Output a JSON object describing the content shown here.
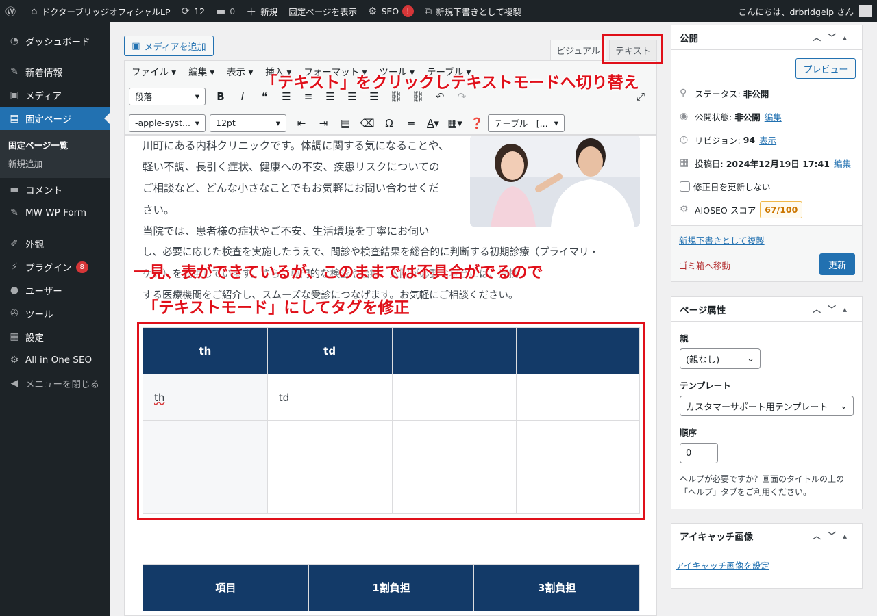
{
  "adminbar": {
    "site_name": "ドクターブリッジオフィシャルLP",
    "updates": "12",
    "comments": "0",
    "new_label": "新規",
    "view_page": "固定ページを表示",
    "seo": "SEO",
    "seo_alert": "!",
    "duplicate": "新規下書きとして複製",
    "greeting": "こんにちは、drbridgelp さん"
  },
  "sidebar": {
    "items": [
      {
        "label": "ダッシュボード",
        "icon": "dashboard-icon"
      },
      {
        "label": "新着情報",
        "icon": "pin-icon"
      },
      {
        "label": "メディア",
        "icon": "media-icon"
      },
      {
        "label": "固定ページ",
        "icon": "page-icon"
      },
      {
        "label": "コメント",
        "icon": "comment-icon"
      },
      {
        "label": "MW WP Form",
        "icon": "pin-icon"
      },
      {
        "label": "外観",
        "icon": "brush-icon"
      },
      {
        "label": "プラグイン",
        "icon": "plugin-icon",
        "badge": "8"
      },
      {
        "label": "ユーザー",
        "icon": "user-icon"
      },
      {
        "label": "ツール",
        "icon": "wrench-icon"
      },
      {
        "label": "設定",
        "icon": "settings-icon"
      },
      {
        "label": "All in One SEO",
        "icon": "aioseo-icon"
      },
      {
        "label": "メニューを閉じる",
        "icon": "collapse-icon"
      }
    ],
    "submenu": [
      "固定ページ一覧",
      "新規追加"
    ]
  },
  "editor": {
    "add_media": "メディアを追加",
    "tab_visual": "ビジュアル",
    "tab_text": "テキスト",
    "menus": [
      "ファイル",
      "編集",
      "表示",
      "挿入",
      "フォーマット",
      "ツール",
      "テーブル"
    ],
    "format_select": "段落",
    "font_select": "-apple-syst...",
    "size_select": "12pt",
    "table_select": "テーブル　[...",
    "paragraph_lines": [
      "川町にある内科クリニックです。体調に関する気になることや、",
      "軽い不調、長引く症状、健康への不安、疾患リスクについての",
      "ご相談など、どんな小さなことでもお気軽にお問い合わせくだ",
      "さい。",
      "当院では、患者様の症状やご不安、生活環境を丁寧にお伺い",
      "し、必要に応じた検査を実施したうえで、問診や検査結果を総合的に判断する初期診療（プライマリ・",
      "ケア）を提供しています。さらに専門的な検査や治療、入院が必要な場合には、連携",
      "する医療機関をご紹介し、スムーズな受診につなげます。お気軽にご相談ください。"
    ],
    "table1": {
      "header": [
        "th",
        "td",
        "",
        "",
        ""
      ],
      "rows": [
        [
          "th",
          "td",
          "",
          "",
          ""
        ],
        [
          "",
          "",
          "",
          "",
          ""
        ],
        [
          "",
          "",
          "",
          "",
          ""
        ]
      ]
    },
    "table2": {
      "header": [
        "項目",
        "1割負担",
        "3割負担"
      ]
    }
  },
  "annotations": {
    "click_text": "「テキスト」をクリックしテキストモードへ切り替え",
    "issue_line1": "一見、表ができているが、このままでは不具合がでるので",
    "issue_line2": "「テキストモード」にしてタグを修正"
  },
  "publish": {
    "title": "公開",
    "preview": "プレビュー",
    "status_label": "ステータス:",
    "status_value": "非公開",
    "visibility_label": "公開状態:",
    "visibility_value": "非公開",
    "edit": "編集",
    "revision_label": "リビジョン:",
    "revision_value": "94",
    "revision_link": "表示",
    "date_label": "投稿日:",
    "date_value": "2024年12月19日 17:41",
    "no_update_date": "修正日を更新しない",
    "aioseo_label": "AIOSEO スコア",
    "aioseo_score": "67/100",
    "duplicate_link": "新規下書きとして複製",
    "trash": "ゴミ箱へ移動",
    "update": "更新"
  },
  "page_attributes": {
    "title": "ページ属性",
    "parent_label": "親",
    "parent_value": "(親なし)",
    "template_label": "テンプレート",
    "template_value": "カスタマーサポート用テンプレート",
    "order_label": "順序",
    "order_value": "0",
    "help": "ヘルプが必要ですか？画面のタイトルの上の「ヘルプ」タブをご利用ください。"
  },
  "featured": {
    "title": "アイキャッチ画像",
    "set_link": "アイキャッチ画像を設定"
  }
}
